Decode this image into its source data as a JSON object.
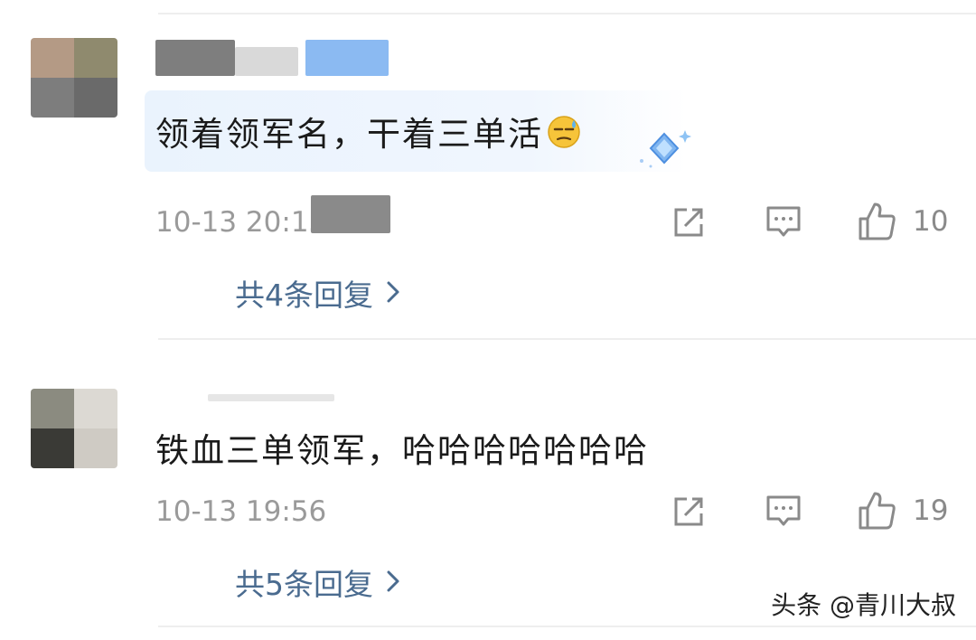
{
  "comments": [
    {
      "text": "领着领军名，干着三单活",
      "emoji": "sweat-smile-emoji",
      "timestamp": "10-13 20:13",
      "like_count": "10",
      "replies_label": "共4条回复"
    },
    {
      "text": "铁血三单领军，哈哈哈哈哈哈哈",
      "timestamp": "10-13 19:56",
      "like_count": "19",
      "replies_label": "共5条回复"
    }
  ],
  "icons": {
    "share": "share-icon",
    "comment": "comment-icon",
    "like": "thumbs-up-icon",
    "chevron": "chevron-right-icon"
  },
  "colors": {
    "reply_link": "#4a6b8f",
    "meta_text": "#9a9a9a",
    "bubble": "#eaf3fd"
  },
  "watermark": "头条 @青川大叔"
}
